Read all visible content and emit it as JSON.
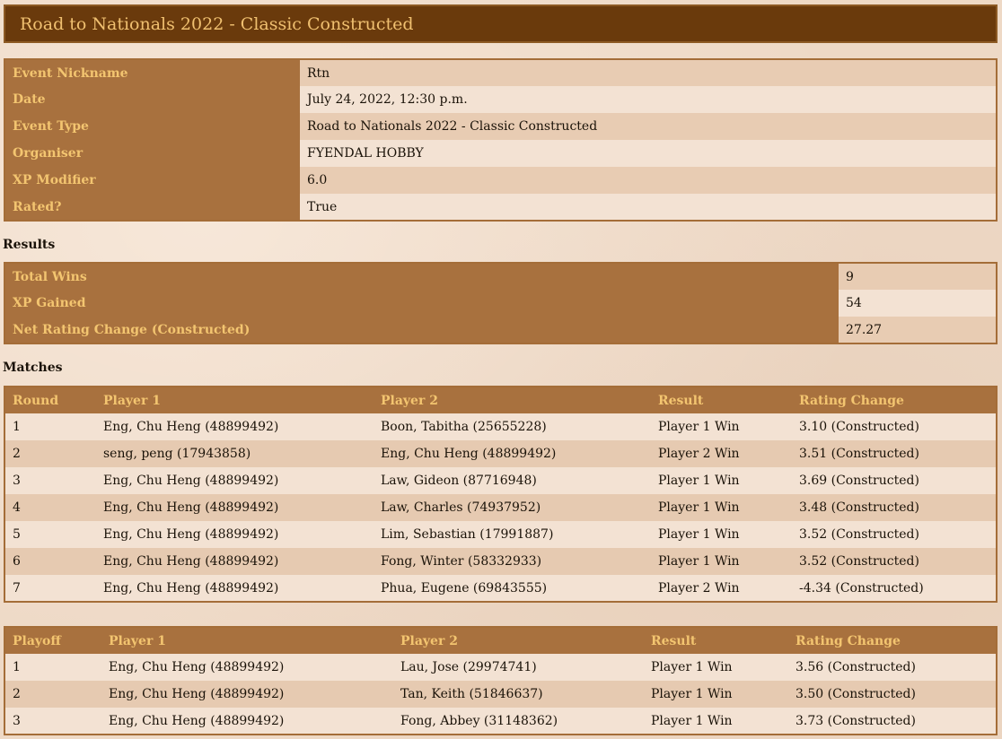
{
  "header": {
    "title": "Road to Nationals 2022 - Classic Constructed"
  },
  "event_details": [
    {
      "label": "Event Nickname",
      "value": "Rtn"
    },
    {
      "label": "Date",
      "value": "July 24, 2022, 12:30 p.m."
    },
    {
      "label": "Event Type",
      "value": "Road to Nationals 2022 - Classic Constructed"
    },
    {
      "label": "Organiser",
      "value": "FYENDAL HOBBY"
    },
    {
      "label": "XP Modifier",
      "value": "6.0"
    },
    {
      "label": "Rated?",
      "value": "True"
    }
  ],
  "results": {
    "title": "Results",
    "rows": [
      {
        "label": "Total Wins",
        "value": "9"
      },
      {
        "label": "XP Gained",
        "value": "54"
      },
      {
        "label": "Net Rating Change (Constructed)",
        "value": "27.27"
      }
    ]
  },
  "matches": {
    "title": "Matches",
    "headers": [
      "Round",
      "Player 1",
      "Player 2",
      "Result",
      "Rating Change"
    ],
    "rows": [
      [
        "1",
        "Eng, Chu Heng (48899492)",
        "Boon, Tabitha (25655228)",
        "Player 1 Win",
        "3.10 (Constructed)"
      ],
      [
        "2",
        "seng, peng (17943858)",
        "Eng, Chu Heng (48899492)",
        "Player 2 Win",
        "3.51 (Constructed)"
      ],
      [
        "3",
        "Eng, Chu Heng (48899492)",
        "Law, Gideon (87716948)",
        "Player 1 Win",
        "3.69 (Constructed)"
      ],
      [
        "4",
        "Eng, Chu Heng (48899492)",
        "Law, Charles (74937952)",
        "Player 1 Win",
        "3.48 (Constructed)"
      ],
      [
        "5",
        "Eng, Chu Heng (48899492)",
        "Lim, Sebastian (17991887)",
        "Player 1 Win",
        "3.52 (Constructed)"
      ],
      [
        "6",
        "Eng, Chu Heng (48899492)",
        "Fong, Winter (58332933)",
        "Player 1 Win",
        "3.52 (Constructed)"
      ],
      [
        "7",
        "Eng, Chu Heng (48899492)",
        "Phua, Eugene (69843555)",
        "Player 2 Win",
        "-4.34 (Constructed)"
      ]
    ]
  },
  "playoffs": {
    "headers": [
      "Playoff",
      "Player 1",
      "Player 2",
      "Result",
      "Rating Change"
    ],
    "rows": [
      [
        "1",
        "Eng, Chu Heng (48899492)",
        "Lau, Jose (29974741)",
        "Player 1 Win",
        "3.56 (Constructed)"
      ],
      [
        "2",
        "Eng, Chu Heng (48899492)",
        "Tan, Keith (51846637)",
        "Player 1 Win",
        "3.50 (Constructed)"
      ],
      [
        "3",
        "Eng, Chu Heng (48899492)",
        "Fong, Abbey (31148362)",
        "Player 1 Win",
        "3.73 (Constructed)"
      ]
    ]
  }
}
